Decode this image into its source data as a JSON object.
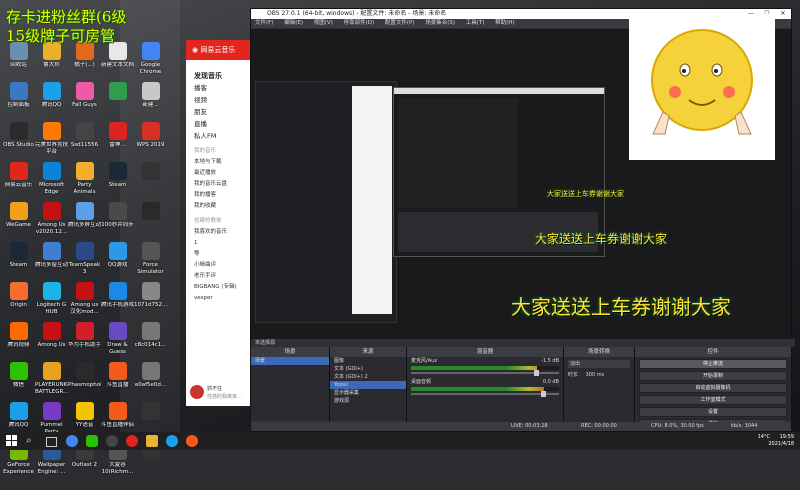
{
  "desktop": {
    "streamer_overlay": [
      "存卡进粉丝群(6级",
      "15级牌子可房管"
    ],
    "icons": [
      {
        "label": "回收站",
        "color": "#6a8fb0"
      },
      {
        "label": "鲁大师",
        "color": "#e9b128"
      },
      {
        "label": "橘子(...)",
        "color": "#e36a1c"
      },
      {
        "label": "新建文本文档",
        "color": "#e8e8e8"
      },
      {
        "label": "Google Chrome",
        "color": "#4285f4"
      },
      {
        "label": "控制面板",
        "color": "#3a78c2"
      },
      {
        "label": "腾讯QQ",
        "color": "#1aa0e8"
      },
      {
        "label": "Fall Guys",
        "color": "#ef5aa5"
      },
      {
        "label": "",
        "color": "#2f9c4e"
      },
      {
        "label": "新建...",
        "color": "#c8c8c8"
      },
      {
        "label": "OBS Studio",
        "color": "#2b2b2b"
      },
      {
        "label": "完美世界竞技平台",
        "color": "#ff7a00"
      },
      {
        "label": "Ssd11556",
        "color": "#444"
      },
      {
        "label": "雷神...",
        "color": "#d22"
      },
      {
        "label": "WPS 2019",
        "color": "#d93025"
      },
      {
        "label": "网易云音乐",
        "color": "#e2261d"
      },
      {
        "label": "Microsoft Edge",
        "color": "#0a84d9"
      },
      {
        "label": "Party Animals",
        "color": "#f2b02a"
      },
      {
        "label": "Steam",
        "color": "#1b2838"
      },
      {
        "label": "",
        "color": "#333"
      },
      {
        "label": "WeGame",
        "color": "#f0a01c"
      },
      {
        "label": "Among Us v2020.12...",
        "color": "#c51111"
      },
      {
        "label": "腾讯多屏互动",
        "color": "#5aa0e6"
      },
      {
        "label": "100秒并同步",
        "color": "#4a4a4a"
      },
      {
        "label": "",
        "color": "#2a2a2a"
      },
      {
        "label": "Steam",
        "color": "#1b2838"
      },
      {
        "label": "腾讯多窗互动",
        "color": "#3f7fd0"
      },
      {
        "label": "TeamSpeak 3",
        "color": "#2a4a8a"
      },
      {
        "label": "QQ游戏",
        "color": "#2a9ae6"
      },
      {
        "label": "Force Simulator",
        "color": "#555"
      },
      {
        "label": "Origin",
        "color": "#f56c2d"
      },
      {
        "label": "Logitech G HUB",
        "color": "#1ab5e8"
      },
      {
        "label": "Among us 汉化mod...",
        "color": "#c51111"
      },
      {
        "label": "腾讯手机游戏",
        "color": "#1a8ae6"
      },
      {
        "label": "1071d752...",
        "color": "#888"
      },
      {
        "label": "腾讯视频",
        "color": "#ff6a00"
      },
      {
        "label": "Among Us",
        "color": "#c51111"
      },
      {
        "label": "华为手机助手",
        "color": "#d31f2a"
      },
      {
        "label": "Draw & Guess",
        "color": "#6a4ac2"
      },
      {
        "label": "c8c014c1...",
        "color": "#777"
      },
      {
        "label": "微信",
        "color": "#2dc100"
      },
      {
        "label": "PLAYERUNKNOWN'S BATTLEGR...",
        "color": "#e9a21d"
      },
      {
        "label": "Phasmophobia",
        "color": "#2a2a2a"
      },
      {
        "label": "斗鱼直播",
        "color": "#f55a1a"
      },
      {
        "label": "e0af5e0d...",
        "color": "#777"
      },
      {
        "label": "腾讯QQ",
        "color": "#1aa0e8"
      },
      {
        "label": "Pummel Party",
        "color": "#7a3ac8"
      },
      {
        "label": "YY语音",
        "color": "#f5c400"
      },
      {
        "label": "斗鱼直播伴侣",
        "color": "#f55a1a"
      },
      {
        "label": "",
        "color": "#333"
      },
      {
        "label": "GeForce Experience",
        "color": "#76b900"
      },
      {
        "label": "Wallpaper Engine: ...",
        "color": "#2a5a9a"
      },
      {
        "label": "Outlast 2",
        "color": "#3a3a3a"
      },
      {
        "label": "大夏谷 10(Richm...",
        "color": "#555"
      },
      {
        "label": "",
        "color": "#333"
      }
    ]
  },
  "netease": {
    "brand": "网易云音乐",
    "nav": [
      "发现音乐",
      "播客",
      "视频",
      "朋友",
      "直播",
      "私人FM"
    ],
    "my_music_title": "我的音乐",
    "my_music": [
      "本地与下载",
      "最近播放",
      "我的音乐云盘",
      "我的播客",
      "我的收藏"
    ],
    "playlist_title": "创建的歌单",
    "playlists": [
      "我喜欢的音乐",
      "1",
      "等",
      "小晰曲评",
      "老乐手评",
      "BIGBANG (专辑)",
      "vesper"
    ],
    "user_name": "抓不住",
    "user_status": "性感的我离家..."
  },
  "obs": {
    "window_title": "OBS 27.0.1 (64-bit, windows) - 配置文件: 未命名 - 场景: 未命名",
    "menu": [
      "文件(F)",
      "编辑(E)",
      "视图(V)",
      "停靠部件(D)",
      "配置文件(P)",
      "场景集合(S)",
      "工具(T)",
      "帮助(H)"
    ],
    "banners": [
      "大家送送上车券谢谢大家",
      "大家送送上车券谢谢大家",
      "大家送送上车券谢谢大家"
    ],
    "source_status": "未选择源",
    "docks": {
      "scenes": {
        "title": "场景",
        "items": [
          "场景"
        ]
      },
      "sources": {
        "title": "来源",
        "items": [
          "图像",
          "文本 (GDI+)",
          "文本 (GDI+) 2",
          "Yoosii",
          "显示器采集",
          "游戏源"
        ]
      },
      "mixer": {
        "title": "混音器",
        "channels": [
          {
            "name": "麦克风/Aux",
            "db": "-1.5 dB",
            "level": 0.85
          },
          {
            "name": "桌面音频",
            "db": "0.0 dB",
            "level": 0.9
          }
        ]
      },
      "transitions": {
        "title": "场景转换",
        "type": "淡出",
        "duration_label": "时长",
        "duration": "300 ms"
      },
      "controls": {
        "title": "控件",
        "buttons": [
          "停止推流",
          "开始录制",
          "启动虚拟摄像机",
          "工作室模式",
          "设置",
          "退出"
        ]
      }
    },
    "status": {
      "live": "LIVE: 00:03:28",
      "rec": "REC: 00:00:00",
      "cpu": "CPU: 8.0%, 30.00 fps",
      "kbps": "kb/s: 3044"
    }
  },
  "taskbar": {
    "apps": [
      "windows",
      "search",
      "taskview",
      "chrome",
      "wechat",
      "obs",
      "netease",
      "folder",
      "qq",
      "douyu"
    ],
    "tray_weather": "14°C",
    "time": "19:59",
    "date": "2021/4/18"
  }
}
